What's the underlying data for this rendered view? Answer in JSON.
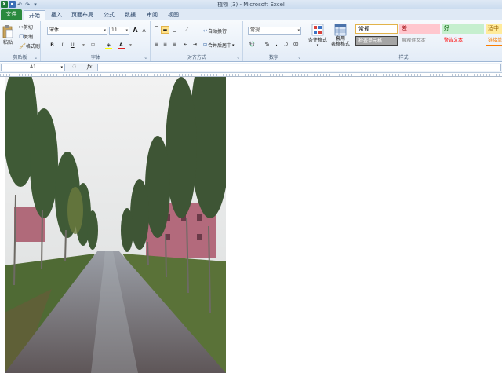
{
  "window": {
    "title": "植物 (3) - Microsoft Excel",
    "app_icon": "excel-icon",
    "qat_icons": [
      "save-icon",
      "undo-icon",
      "redo-icon",
      "customize-icon"
    ]
  },
  "tabs": [
    {
      "label": "文件",
      "active": false,
      "file": true
    },
    {
      "label": "开始",
      "active": true
    },
    {
      "label": "插入",
      "active": false
    },
    {
      "label": "页面布局",
      "active": false
    },
    {
      "label": "公式",
      "active": false
    },
    {
      "label": "数据",
      "active": false
    },
    {
      "label": "审阅",
      "active": false
    },
    {
      "label": "视图",
      "active": false
    }
  ],
  "ribbon": {
    "clipboard": {
      "label": "剪贴板",
      "paste": "粘贴",
      "cut": "剪切",
      "copy": "复制",
      "format_painter": "格式刷"
    },
    "font": {
      "label": "字体",
      "font_name": "宋体",
      "font_size": "11",
      "bold": "B",
      "italic": "I",
      "underline": "U",
      "grow": "A",
      "shrink": "A",
      "font_color": "#e02020",
      "fill_color": "#ffff00"
    },
    "alignment": {
      "label": "对齐方式",
      "wrap_text": "自动换行",
      "merge_center": "合并后居中"
    },
    "number": {
      "label": "数字",
      "format": "常规",
      "percent": "%",
      "comma": ","
    },
    "styles": {
      "label": "样式",
      "conditional_format": "条件格式",
      "format_as_table_line1": "套用",
      "format_as_table_line2": "表格格式",
      "cells": [
        {
          "label": "常规",
          "bg": "#ffffff",
          "fg": "#000000"
        },
        {
          "label": "差",
          "bg": "#ffc7ce",
          "fg": "#9c0006"
        },
        {
          "label": "好",
          "bg": "#c6efce",
          "fg": "#006100"
        },
        {
          "label": "适中",
          "bg": "#ffeb9c",
          "fg": "#9c6500"
        },
        {
          "label": "检查单元格",
          "bg": "#a5a5a5",
          "fg": "#ffffff"
        },
        {
          "label": "解释性文本",
          "bg": "#ffffff",
          "fg": "#7f7f7f"
        },
        {
          "label": "警告文本",
          "bg": "#ffffff",
          "fg": "#ff0000"
        },
        {
          "label": "链接单",
          "bg": "#ffffff",
          "fg": "#fa7d00"
        }
      ]
    }
  },
  "formula_bar": {
    "name_box": "A1",
    "fx_label": "fx",
    "formula": ""
  }
}
